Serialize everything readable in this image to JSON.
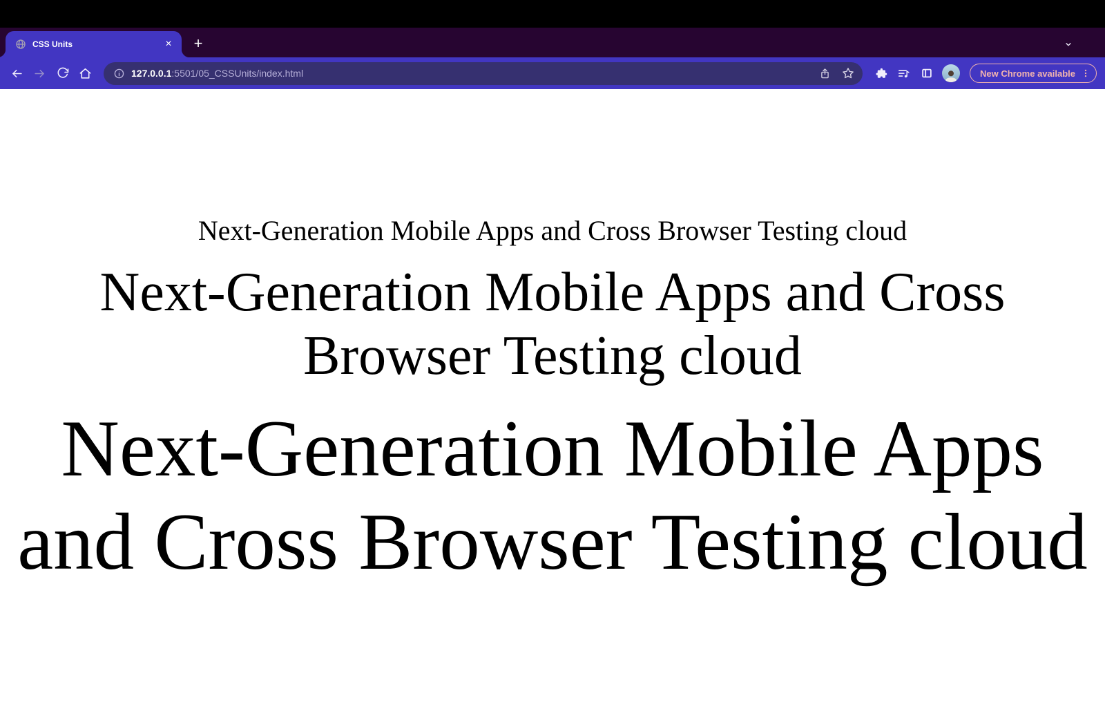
{
  "theme": {
    "top-bar": "#000000",
    "tab-strip": "#270531",
    "toolbar": "#4236c2",
    "address-bar": "#363070",
    "icon": "#f1eefc",
    "icon-dim": "#9189c9",
    "url-host": "#ffffff",
    "url-path": "#b6afd8",
    "favicon": "#a6a1b2",
    "update-accent": "#f2b4ae",
    "page-bg": "#ffffff",
    "page-text": "#000000"
  },
  "browser": {
    "tab_title": "CSS Units",
    "close_glyph": "×",
    "new_tab_glyph": "+",
    "url_host": "127.0.0.1",
    "url_path": ":5501/05_CSSUnits/index.html",
    "update_label": "New Chrome available"
  },
  "icons": {
    "favicon": "globe-icon",
    "back": "back-arrow-icon",
    "forward": "forward-arrow-icon",
    "reload": "reload-icon",
    "home": "home-icon",
    "site_info": "info-circle-icon",
    "share": "share-icon",
    "bookmark": "star-icon",
    "extensions": "puzzle-icon",
    "media": "media-queue-icon",
    "side_panel": "side-panel-icon",
    "menu": "kebab-menu-icon",
    "tab_overflow": "chevron-down-icon"
  },
  "page": {
    "small_text": "Next-Generation Mobile Apps and Cross Browser Testing cloud",
    "medium_lines": [
      "Next-Generation Mobile Apps and Cross",
      "Browser Testing cloud"
    ],
    "large_lines": [
      "Next-Generation Mobile Apps",
      "and Cross Browser Testing cloud"
    ]
  }
}
